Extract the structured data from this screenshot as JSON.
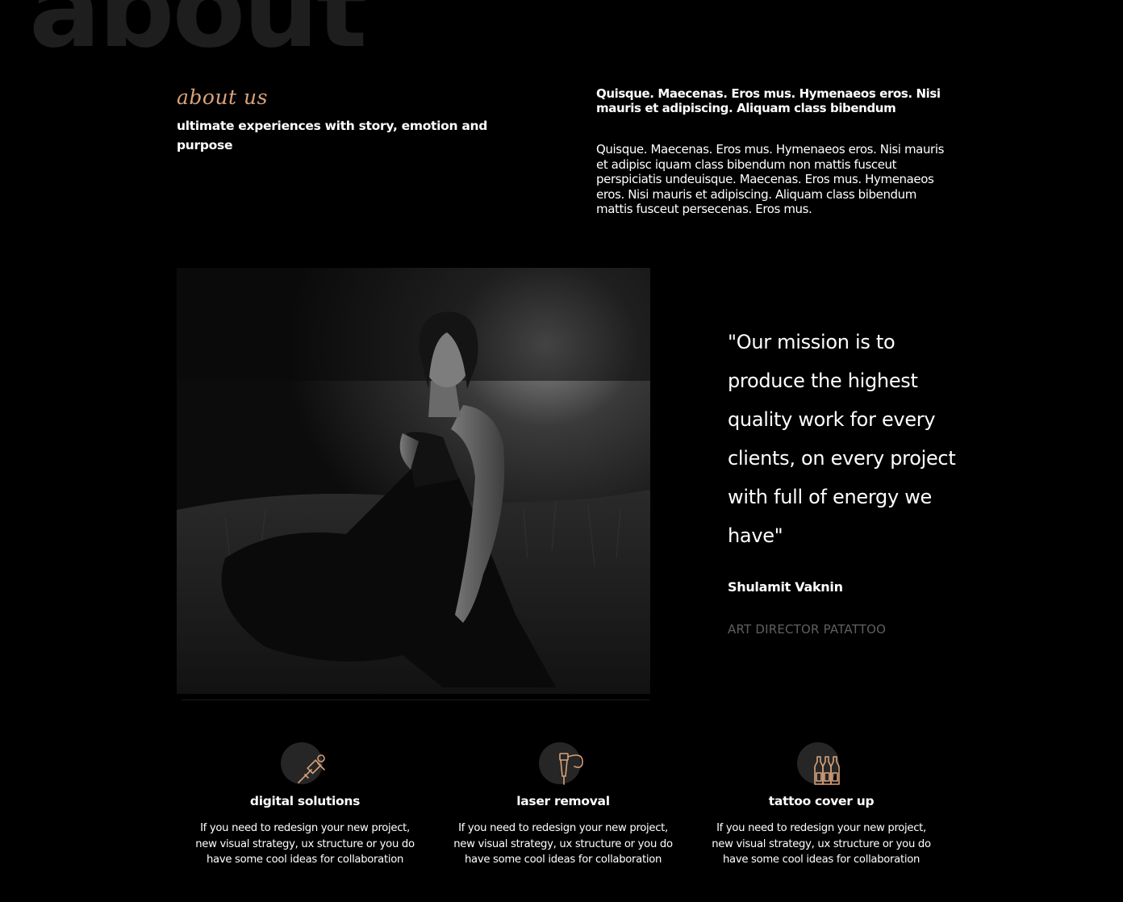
{
  "background_word": "about",
  "about": {
    "eyebrow": "about us",
    "headline": "ultimate experiences with story, emotion and purpose"
  },
  "intro": {
    "bold": "Quisque. Maecenas. Eros mus. Hymenaeos eros. Nisi mauris et adipiscing. Aliquam class bibendum",
    "body": "Quisque. Maecenas. Eros mus. Hymenaeos eros. Nisi mauris et adipisc iquam class bibendum non mattis fusceut perspiciatis undeuisque. Maecenas. Eros mus. Hymenaeos eros. Nisi mauris et adipiscing. Aliquam class bibendum mattis fusceut persecenas. Eros mus."
  },
  "quote": {
    "text": "\"Our mission is to produce the highest quality work for every clients, on every project with full of energy we have\"",
    "author": "Shulamit Vaknin",
    "role": "ART DIRECTOR PATATTOO"
  },
  "services": [
    {
      "icon": "tattoo-machine-icon",
      "title": "digital solutions",
      "description": "If you need to redesign your new project, new visual strategy, ux structure or you do have some cool ideas for collaboration"
    },
    {
      "icon": "tattoo-pen-icon",
      "title": "laser removal",
      "description": "If you need to redesign your new project, new visual strategy, ux structure or you do have some cool ideas for collaboration"
    },
    {
      "icon": "ink-bottles-icon",
      "title": "tattoo cover up",
      "description": "If you need to redesign your new project, new visual strategy, ux structure or you do have some cool ideas for collaboration"
    }
  ],
  "colors": {
    "accent": "#d8a27a",
    "background": "#000000",
    "muted": "#5f5f5f"
  }
}
